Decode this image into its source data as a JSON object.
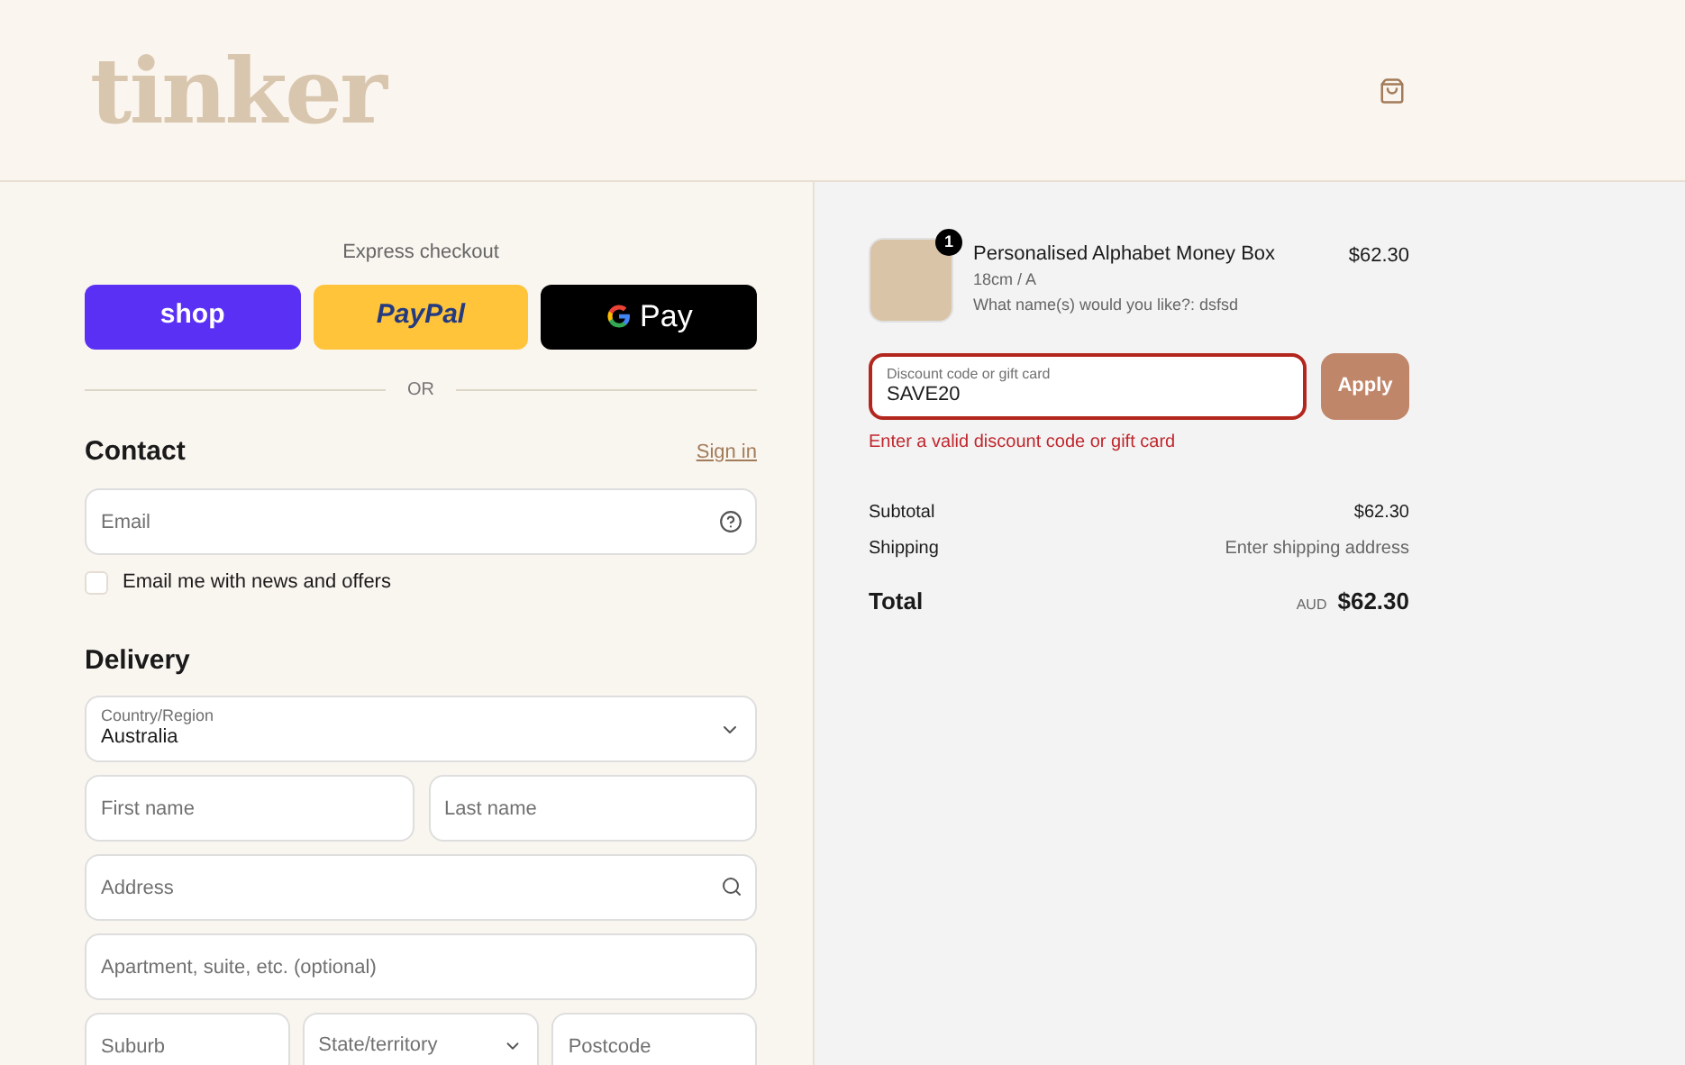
{
  "header": {
    "logo": "tinker"
  },
  "express_checkout": {
    "title": "Express checkout",
    "buttons": [
      {
        "kind": "shop",
        "label": "shop"
      },
      {
        "kind": "paypal",
        "label": "PayPal"
      },
      {
        "kind": "gpay",
        "label": "Pay"
      }
    ],
    "divider": "OR"
  },
  "contact": {
    "title": "Contact",
    "link": "Sign in",
    "email": {
      "placeholder": "Email"
    },
    "newsletter": {
      "label": "Email me with news and offers",
      "checked": false
    }
  },
  "delivery": {
    "title": "Delivery",
    "country": {
      "label": "Country/Region",
      "value": "Australia"
    },
    "first_name": {
      "placeholder": "First name"
    },
    "last_name": {
      "placeholder": "Last name"
    },
    "address": {
      "placeholder": "Address"
    },
    "apartment": {
      "placeholder": "Apartment, suite, etc. (optional)"
    },
    "suburb": {
      "placeholder": "Suburb"
    },
    "state": {
      "placeholder": "State/territory"
    },
    "postcode": {
      "placeholder": "Postcode"
    }
  },
  "order": {
    "item": {
      "quantity": "1",
      "name": "Personalised Alphabet Money Box",
      "variant": "18cm / A",
      "note": "What name(s) would you like?: dsfsd",
      "price": "$62.30"
    },
    "discount": {
      "label": "Discount code or gift card",
      "value": "SAVE20",
      "error": true,
      "error_text": "Enter a valid discount code or gift card",
      "button": "Apply"
    },
    "summary": [
      {
        "label": "Subtotal",
        "value": "$62.30"
      },
      {
        "label": "Shipping",
        "value": "Enter shipping address"
      }
    ],
    "total": {
      "label": "Total",
      "currency": "AUD",
      "value": "$62.30"
    }
  }
}
